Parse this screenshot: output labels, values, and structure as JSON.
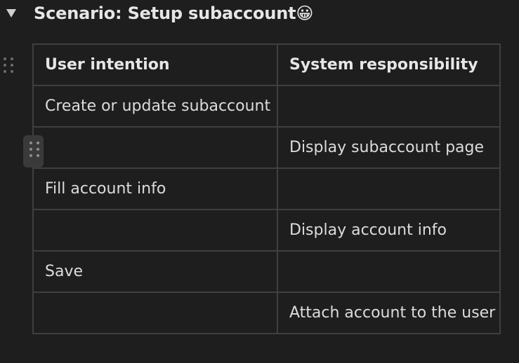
{
  "heading": {
    "title": "Scenario: Setup subaccount😀"
  },
  "table": {
    "headers": [
      "User intention",
      "System responsibility"
    ],
    "rows": [
      [
        "Create or update subaccount",
        ""
      ],
      [
        "",
        "Display subaccount page"
      ],
      [
        "Fill account info",
        ""
      ],
      [
        "",
        "Display account info"
      ],
      [
        "Save",
        ""
      ],
      [
        "",
        "Attach account to the user"
      ]
    ]
  },
  "icons": {
    "toggle": "triangle-down-icon",
    "block_handle": "drag-handle-icon",
    "row_handle": "drag-handle-icon"
  },
  "colors": {
    "background": "#1e1e1e",
    "text": "#dcdcdc",
    "border": "#3f3f3f",
    "handle_bg": "#3a3a3a"
  }
}
